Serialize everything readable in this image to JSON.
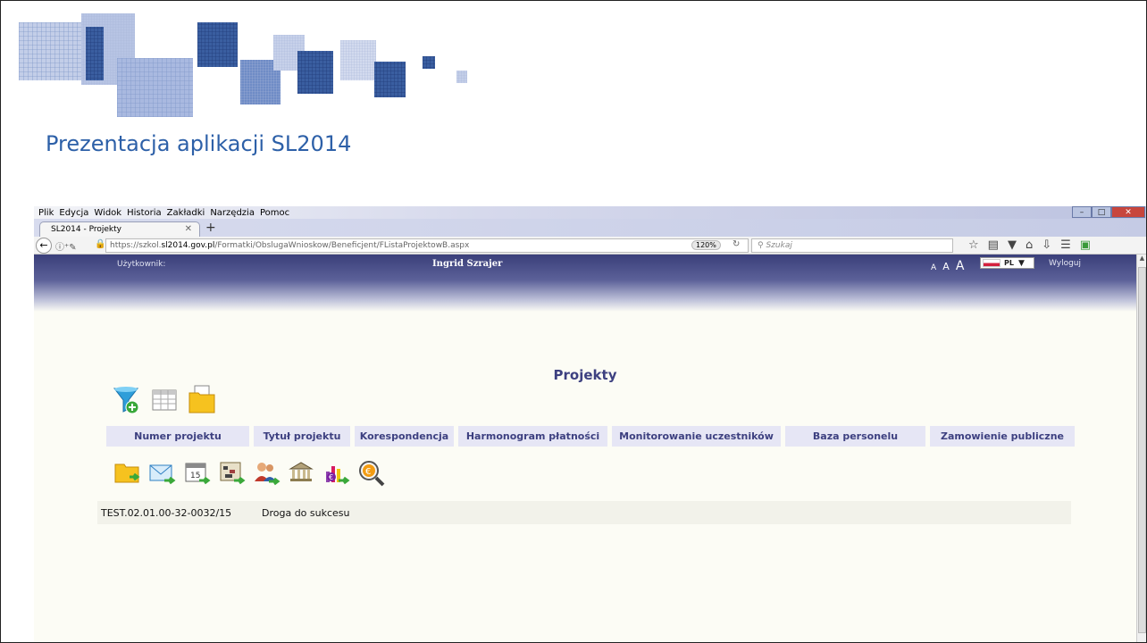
{
  "slide": {
    "title": "Prezentacja aplikacji SL2014"
  },
  "browser": {
    "menu": [
      "Plik",
      "Edycja",
      "Widok",
      "Historia",
      "Zakładki",
      "Narzędzia",
      "Pomoc"
    ],
    "tab_title": "SL2014 - Projekty",
    "url_prefix": "https://szkol.",
    "url_domain": "sl2014.gov.pl",
    "url_path": "/Formatki/ObslugaWnioskow/Beneficjent/FListaProjektowB.aspx",
    "zoom": "120%",
    "search_placeholder": "Szukaj"
  },
  "app": {
    "user_label": "Użytkownik:",
    "user_name": "Ingrid Szrajer",
    "font_sizes": [
      "A",
      "A",
      "A"
    ],
    "language": "PL",
    "logout": "Wyloguj",
    "page_heading": "Projekty",
    "columns": [
      "Numer projektu",
      "Tytuł projektu",
      "Korespondencja",
      "Harmonogram płatności",
      "Monitorowanie uczestników",
      "Baza personelu",
      "Zamowienie publiczne"
    ],
    "rows": [
      {
        "number": "TEST.02.01.00-32-0032/15",
        "title": "Droga do sukcesu"
      }
    ],
    "colors": {
      "accent": "#3d4080",
      "header_dark": "#3a3f7a",
      "slide_title": "#2d60a8",
      "column_bg": "#e6e6f5"
    }
  }
}
